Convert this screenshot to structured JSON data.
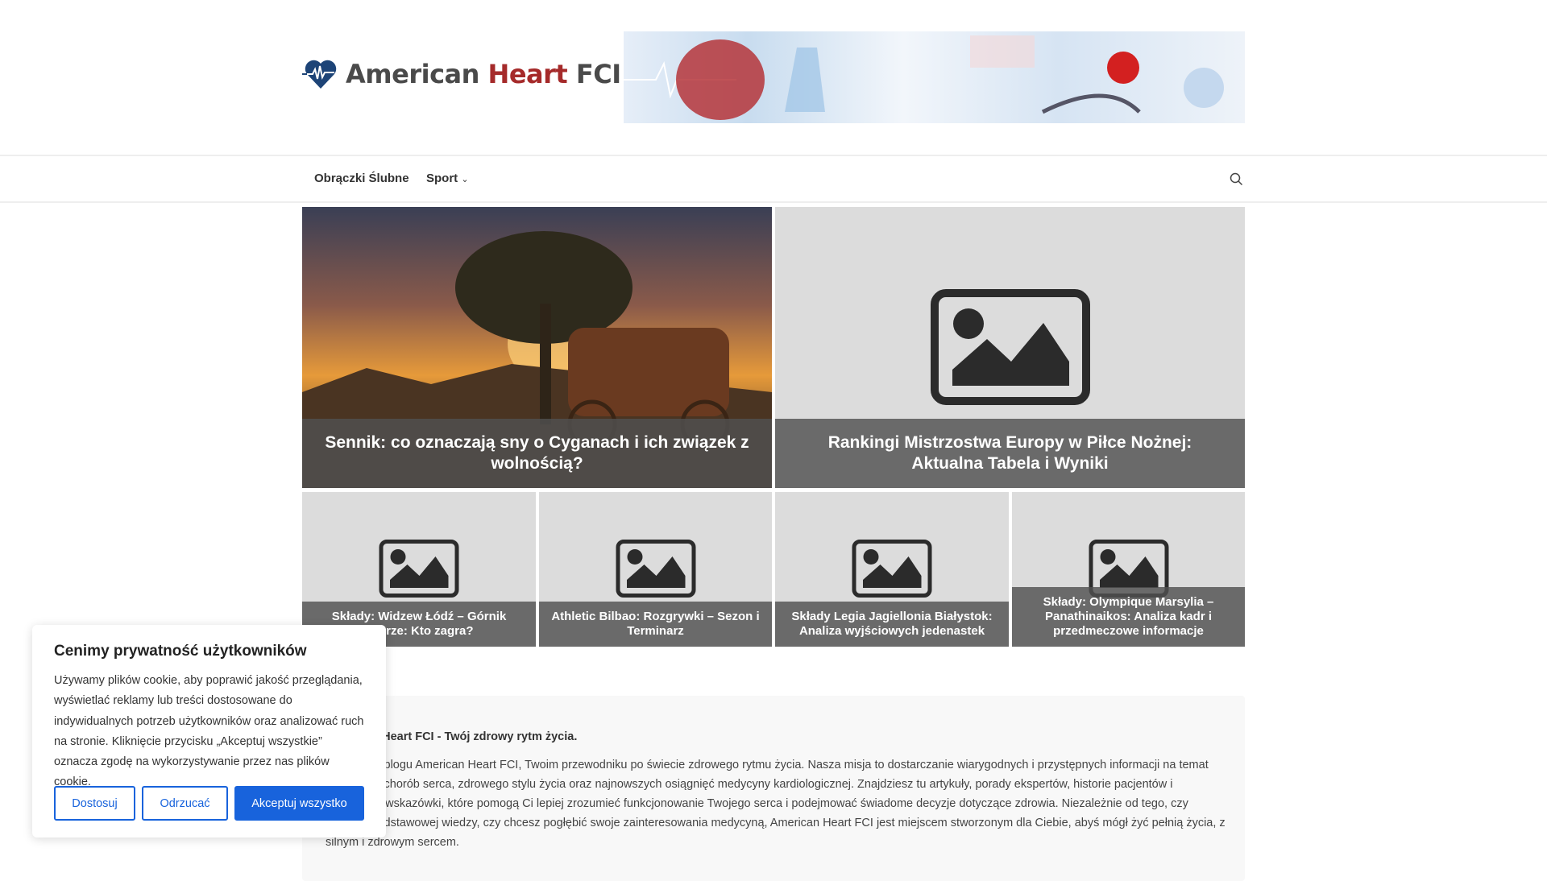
{
  "site": {
    "logo_part1": "American ",
    "logo_part2": "Heart",
    "logo_part3": " FCI"
  },
  "nav": {
    "items": [
      {
        "label": "Obrączki Ślubne"
      },
      {
        "label": "Sport"
      }
    ],
    "sport_chevron": "⌄"
  },
  "featured": [
    {
      "title": "Sennik: co oznaczają sny o Cyganach i ich związek z wolnością?"
    },
    {
      "title": "Rankingi Mistrzostwa Europy w Piłce Nożnej: Aktualna Tabela i Wyniki"
    }
  ],
  "posts": [
    {
      "title": "Składy: Widzew Łódź – Górnik Zabrze: Kto zagra?"
    },
    {
      "title": "Athletic Bilbao: Rozgrywki – Sezon i Terminarz"
    },
    {
      "title": "Składy Legia Jagiellonia Białystok: Analiza wyjściowych jedenastek"
    },
    {
      "title": "Składy: Olympique Marsylia – Panathinaikos: Analiza kadr i przedmeczowe informacje"
    }
  ],
  "about": {
    "heading": "American Heart FCI - Twój zdrowy rytm życia.",
    "text": "Witamy na blogu American Heart FCI, Twoim przewodniku po świecie zdrowego rytmu życia. Nasza misja to dostarczanie wiarygodnych i przystępnych informacji na temat profilaktyki chorób serca, zdrowego stylu życia oraz najnowszych osiągnięć medycyny kardiologicznej. Znajdziesz tu artykuły, porady ekspertów, historie pacjentów i praktyczne wskazówki, które pomogą Ci lepiej zrozumieć funkcjonowanie Twojego serca i podejmować świadome decyzje dotyczące zdrowia. Niezależnie od tego, czy szukasz podstawowej wiedzy, czy chcesz pogłębić swoje zainteresowania medycyną, American Heart FCI jest miejscem stworzonym dla Ciebie, abyś mógł żyć pełnią życia, z silnym i zdrowym sercem."
  },
  "cookie": {
    "title": "Cenimy prywatność użytkowników",
    "text": "Używamy plików cookie, aby poprawić jakość przeglądania, wyświetlać reklamy lub treści dostosowane do indywidualnych potrzeb użytkowników oraz analizować ruch na stronie. Kliknięcie przycisku „Akceptuj wszystkie” oznacza zgodę na wykorzystywanie przez nas plików cookie.",
    "customize": "Dostosuj",
    "reject": "Odrzucać",
    "accept": "Akceptuj wszystko"
  },
  "colors": {
    "accent": "#1863dc",
    "logo_red": "#a52a2a",
    "logo_blue": "#1d4477"
  }
}
